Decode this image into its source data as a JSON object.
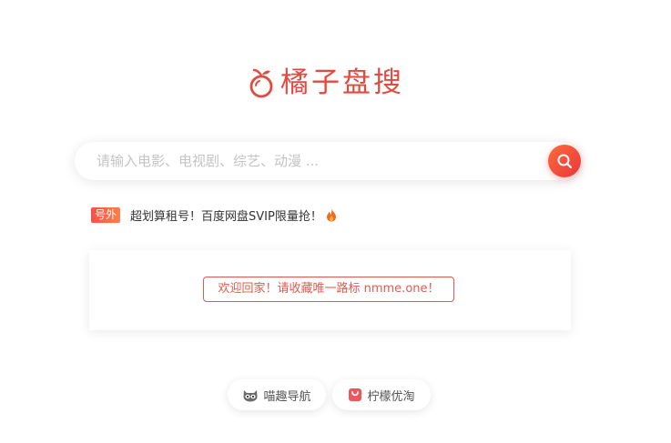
{
  "logo": {
    "text": "橘子盘搜",
    "icon": "orange-icon",
    "color": "#e34a3f"
  },
  "search": {
    "placeholder": "请输入电影、电视剧、综艺、动漫 ...",
    "value": "",
    "button_icon": "search-icon",
    "button_colors": [
      "#ff6a3d",
      "#e8373a"
    ]
  },
  "promo": {
    "badge": "号外",
    "text": "超划算租号！百度网盘SVIP限量抢！",
    "icon": "fire-icon"
  },
  "notice": {
    "text": "欢迎回家！请收藏唯一路标 nmme.one！",
    "color": "#e05a4f"
  },
  "links": [
    {
      "label": "喵趣导航",
      "icon": "cat-face-icon"
    },
    {
      "label": "柠檬优淘",
      "icon": "shopping-bag-icon"
    }
  ]
}
